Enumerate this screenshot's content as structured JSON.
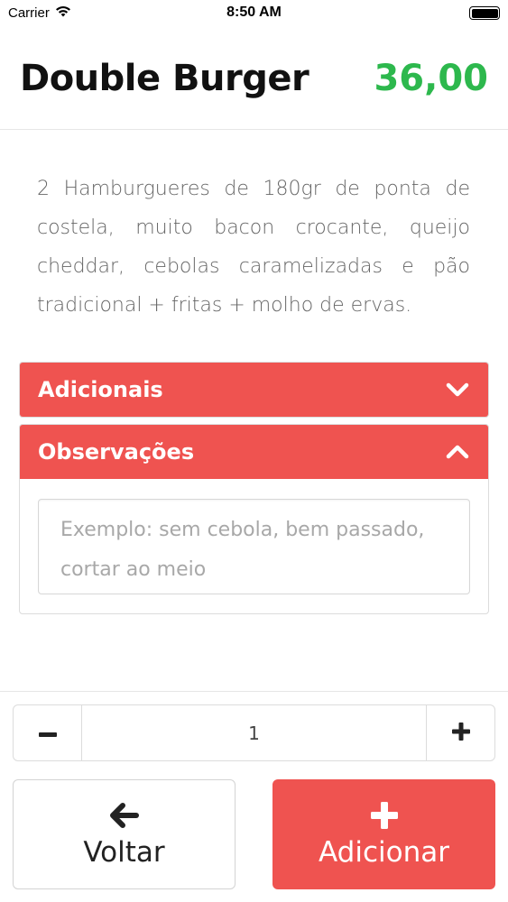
{
  "status_bar": {
    "carrier": "Carrier",
    "time": "8:50 AM",
    "wifi_icon": "wifi-icon",
    "battery_icon": "battery-icon"
  },
  "product": {
    "title": "Double Burger",
    "price": "36,00",
    "price_color": "#2db84d",
    "description": "2 Hamburgueres de 180gr de ponta de costela, muito bacon crocante, queijo cheddar, cebolas caramelizadas e pão tradicional + fritas + molho de ervas."
  },
  "accordion": {
    "accent_color": "#ef5350",
    "adicionais": {
      "label": "Adicionais",
      "state": "collapsed",
      "icon": "chevron-down-icon"
    },
    "observacoes": {
      "label": "Observações",
      "state": "expanded",
      "icon": "chevron-up-icon",
      "notes_value": "",
      "notes_placeholder": "Exemplo: sem cebola, bem passado, cortar ao meio"
    }
  },
  "quantity": {
    "minus_icon": "minus-icon",
    "value": "1",
    "plus_icon": "plus-icon"
  },
  "actions": {
    "back": {
      "label": "Voltar",
      "icon": "arrow-left-icon"
    },
    "add": {
      "label": "Adicionar",
      "icon": "plus-icon"
    }
  }
}
